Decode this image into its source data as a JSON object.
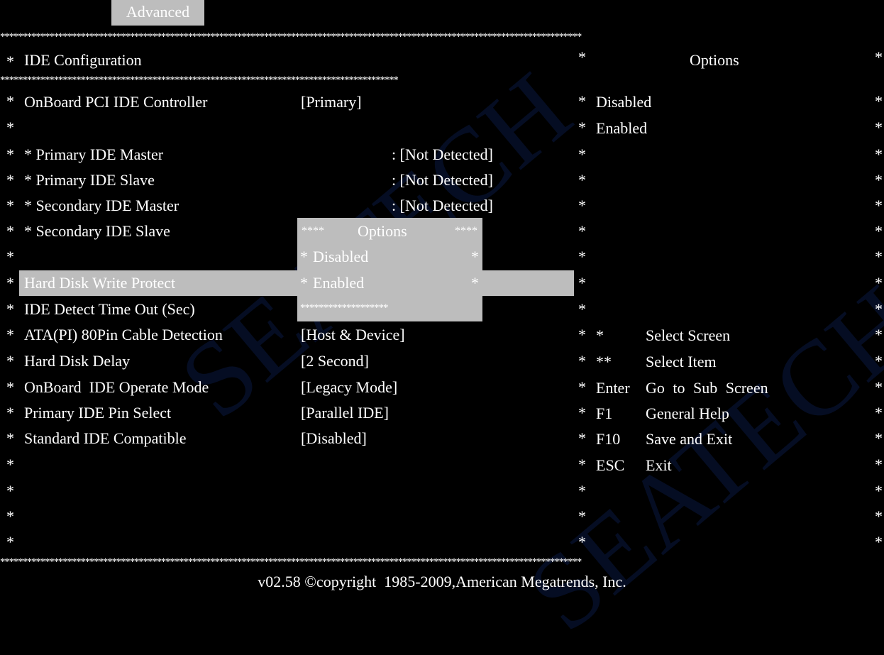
{
  "tab": {
    "label": "Advanced"
  },
  "border": {
    "full": "**********************************************************************************************************************************",
    "section": "*****************************************************************************************",
    "popup_bottom": "*******************"
  },
  "section": {
    "title": "IDE Configuration"
  },
  "help_panel": {
    "title": "Options",
    "options": [
      "Disabled",
      "Enabled"
    ],
    "keys": [
      {
        "key": "*",
        "desc": "Select Screen"
      },
      {
        "key": "**",
        "desc": "Select Item"
      },
      {
        "key": "Enter",
        "desc": "Go to Sub Screen"
      },
      {
        "key": "F1",
        "desc": "General Help"
      },
      {
        "key": "F10",
        "desc": "Save and Exit"
      },
      {
        "key": "ESC",
        "desc": "Exit"
      }
    ]
  },
  "settings": {
    "onboard_pci": {
      "label": "OnBoard PCI IDE Controller",
      "value": "[Primary]"
    },
    "drives": [
      {
        "label": "* Primary IDE Master",
        "value": ": [Not Detected]"
      },
      {
        "label": "* Primary IDE Slave",
        "value": ": [Not Detected]"
      },
      {
        "label": "* Secondary IDE Master",
        "value": ": [Not Detected]"
      },
      {
        "label": "* Secondary IDE Slave",
        "value": ""
      }
    ],
    "hdd_write_protect": {
      "label": "Hard Disk Write Protect"
    },
    "detect_timeout": {
      "label": "IDE Detect Time Out (Sec)"
    },
    "ata80": {
      "label": "ATA(PI) 80Pin Cable Detection",
      "value": "[Host & Device]"
    },
    "hdd_delay": {
      "label": "Hard Disk Delay",
      "value": "[2 Second]"
    },
    "operate_mode": {
      "label": "OnBoard  IDE Operate Mode",
      "value": "[Legacy Mode]"
    },
    "pin_select": {
      "label": "Primary IDE Pin Select",
      "value": "[Parallel IDE]"
    },
    "std_compat": {
      "label": "Standard IDE Compatible",
      "value": "[Disabled]"
    }
  },
  "popup": {
    "title_stars": "****",
    "title": "Options",
    "items": [
      "Disabled",
      "Enabled"
    ],
    "bullet": "*"
  },
  "footer": {
    "copyright": "v02.58 ©copyright  1985-2009,American Megatrends, Inc."
  },
  "watermark": {
    "text": "SEATECH"
  },
  "colors": {
    "background": "#000000",
    "highlight": "#bdbdbd",
    "text": "#ffffff"
  }
}
